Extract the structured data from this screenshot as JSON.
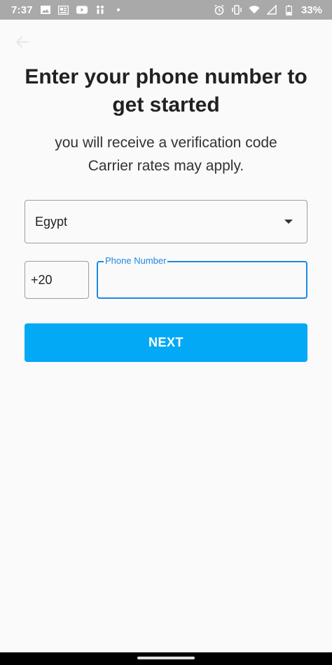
{
  "status_bar": {
    "time": "7:37",
    "battery": "33%",
    "left_icons": [
      "image-icon",
      "news-icon",
      "youtube-icon",
      "walk-icon",
      "dot-icon"
    ],
    "right_icons": [
      "alarm-icon",
      "vibrate-icon",
      "wifi-icon",
      "signal-icon",
      "battery-icon"
    ]
  },
  "header": {
    "title_line1": "Enter your phone number to",
    "title_line2": "get started",
    "subtitle_line1": "you will receive a verification code",
    "subtitle_line2": "Carrier rates may apply."
  },
  "form": {
    "country": "Egypt",
    "country_code": "+20",
    "phone_label": "Phone Number",
    "phone_value": ""
  },
  "actions": {
    "next_label": "NEXT"
  },
  "colors": {
    "accent": "#03a9f4",
    "focus": "#1e88e5",
    "background": "#fafafa"
  }
}
